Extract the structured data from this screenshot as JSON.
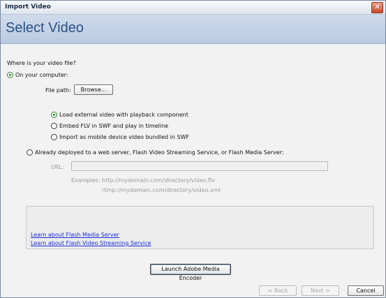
{
  "window": {
    "title": "Import Video"
  },
  "header": {
    "page_title": "Select Video"
  },
  "main": {
    "question": "Where is your video file?",
    "on_computer_label": "On your computer:",
    "file_path_label": "File path:",
    "browse_label": "Browse...",
    "options": [
      {
        "label": "Load external video with playback component",
        "selected": true
      },
      {
        "label": "Embed FLV in SWF and play in timeline",
        "selected": false
      },
      {
        "label": "Import as mobile device video bundled in SWF",
        "selected": false
      }
    ],
    "deployed_label": "Already deployed to a web server, Flash Video Streaming Service, or Flash Media Server:",
    "url_label": "URL:",
    "url_value": "",
    "examples_label": "Examples:",
    "example_1": "http://mydomain.com/directory/video.flv",
    "example_2": "rtmp://mydomain.com/directory/video.xml"
  },
  "links": {
    "learn_fms": "Learn about Flash Media Server",
    "learn_fvss": "Learn about Flash Video Streaming Service"
  },
  "footer": {
    "launch_encoder_label": "Launch Adobe Media Encoder",
    "back_label": "< Back",
    "next_label": "Next >",
    "cancel_label": "Cancel"
  }
}
